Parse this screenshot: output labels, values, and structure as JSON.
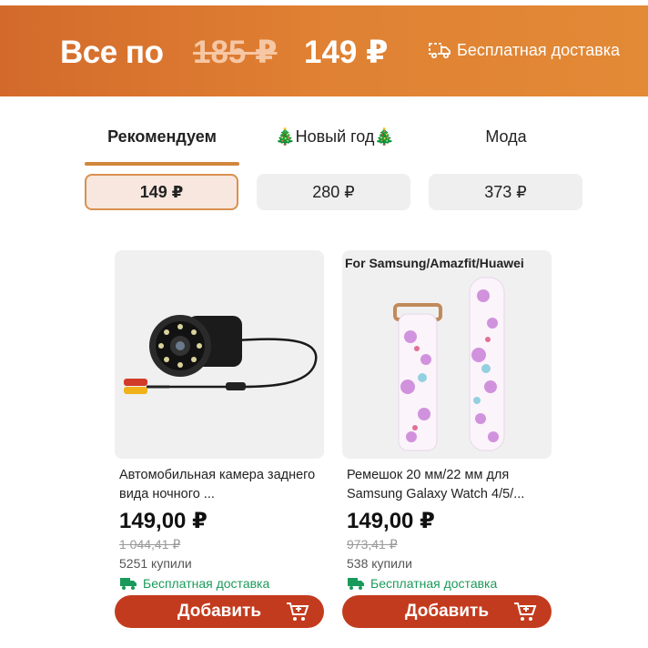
{
  "banner": {
    "prefix": "Все по",
    "old_price": "185 ₽",
    "new_price": "149 ₽",
    "shipping": "Бесплатная доставка"
  },
  "tabs": [
    {
      "label": "Рекомендуем",
      "active": true
    },
    {
      "label": "🎄Новый год🎄",
      "active": false
    },
    {
      "label": "Мода",
      "active": false
    }
  ],
  "price_chips": [
    {
      "label": "149 ₽",
      "selected": true
    },
    {
      "label": "280 ₽",
      "selected": false
    },
    {
      "label": "373 ₽",
      "selected": false
    }
  ],
  "products": [
    {
      "image_icon": "car-camera-image",
      "title": "Автомобильная камера заднего вида ночного ...",
      "price": "149,00 ₽",
      "old_price": "1 044,41 ₽",
      "sold": "5251 купили",
      "delivery": "Бесплатная доставка",
      "button": "Добавить"
    },
    {
      "image_icon": "watch-strap-image",
      "image_caption": "For Samsung/Amazfit/Huawei",
      "title": "Ремешок 20 мм/22 мм для Samsung Galaxy Watch 4/5/...",
      "price": "149,00 ₽",
      "old_price": "973,41 ₽",
      "sold": "538 купили",
      "delivery": "Бесплатная доставка",
      "button": "Добавить"
    }
  ],
  "colors": {
    "banner": "#e08133",
    "accent": "#d2863c",
    "add_button": "#c33b1e",
    "delivery_green": "#1a9a5a"
  }
}
